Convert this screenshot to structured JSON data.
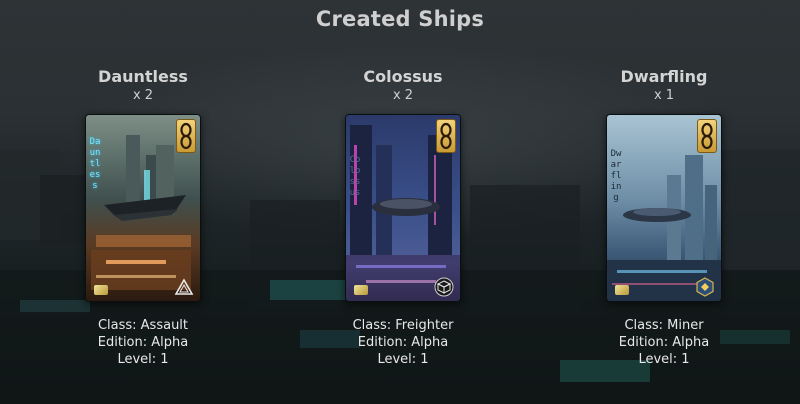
{
  "page": {
    "title": "Created Ships"
  },
  "ships": [
    {
      "name": "Dauntless",
      "count": "x 2",
      "card_label": "Dauntless",
      "class": "Class: Assault",
      "edition": "Edition: Alpha",
      "level": "Level: 1",
      "class_icon": "triangle-icon",
      "accent": "#2bc9ff"
    },
    {
      "name": "Colossus",
      "count": "x 2",
      "card_label": "Colossus",
      "class": "Class: Freighter",
      "edition": "Edition: Alpha",
      "level": "Level: 1",
      "class_icon": "crate-icon",
      "accent": "#8a7cff"
    },
    {
      "name": "Dwarfling",
      "count": "x 1",
      "card_label": "Dwarfling",
      "class": "Class: Miner",
      "edition": "Edition: Alpha",
      "level": "Level: 1",
      "class_icon": "hexagon-gem-icon",
      "accent": "#3aa9ff"
    }
  ]
}
